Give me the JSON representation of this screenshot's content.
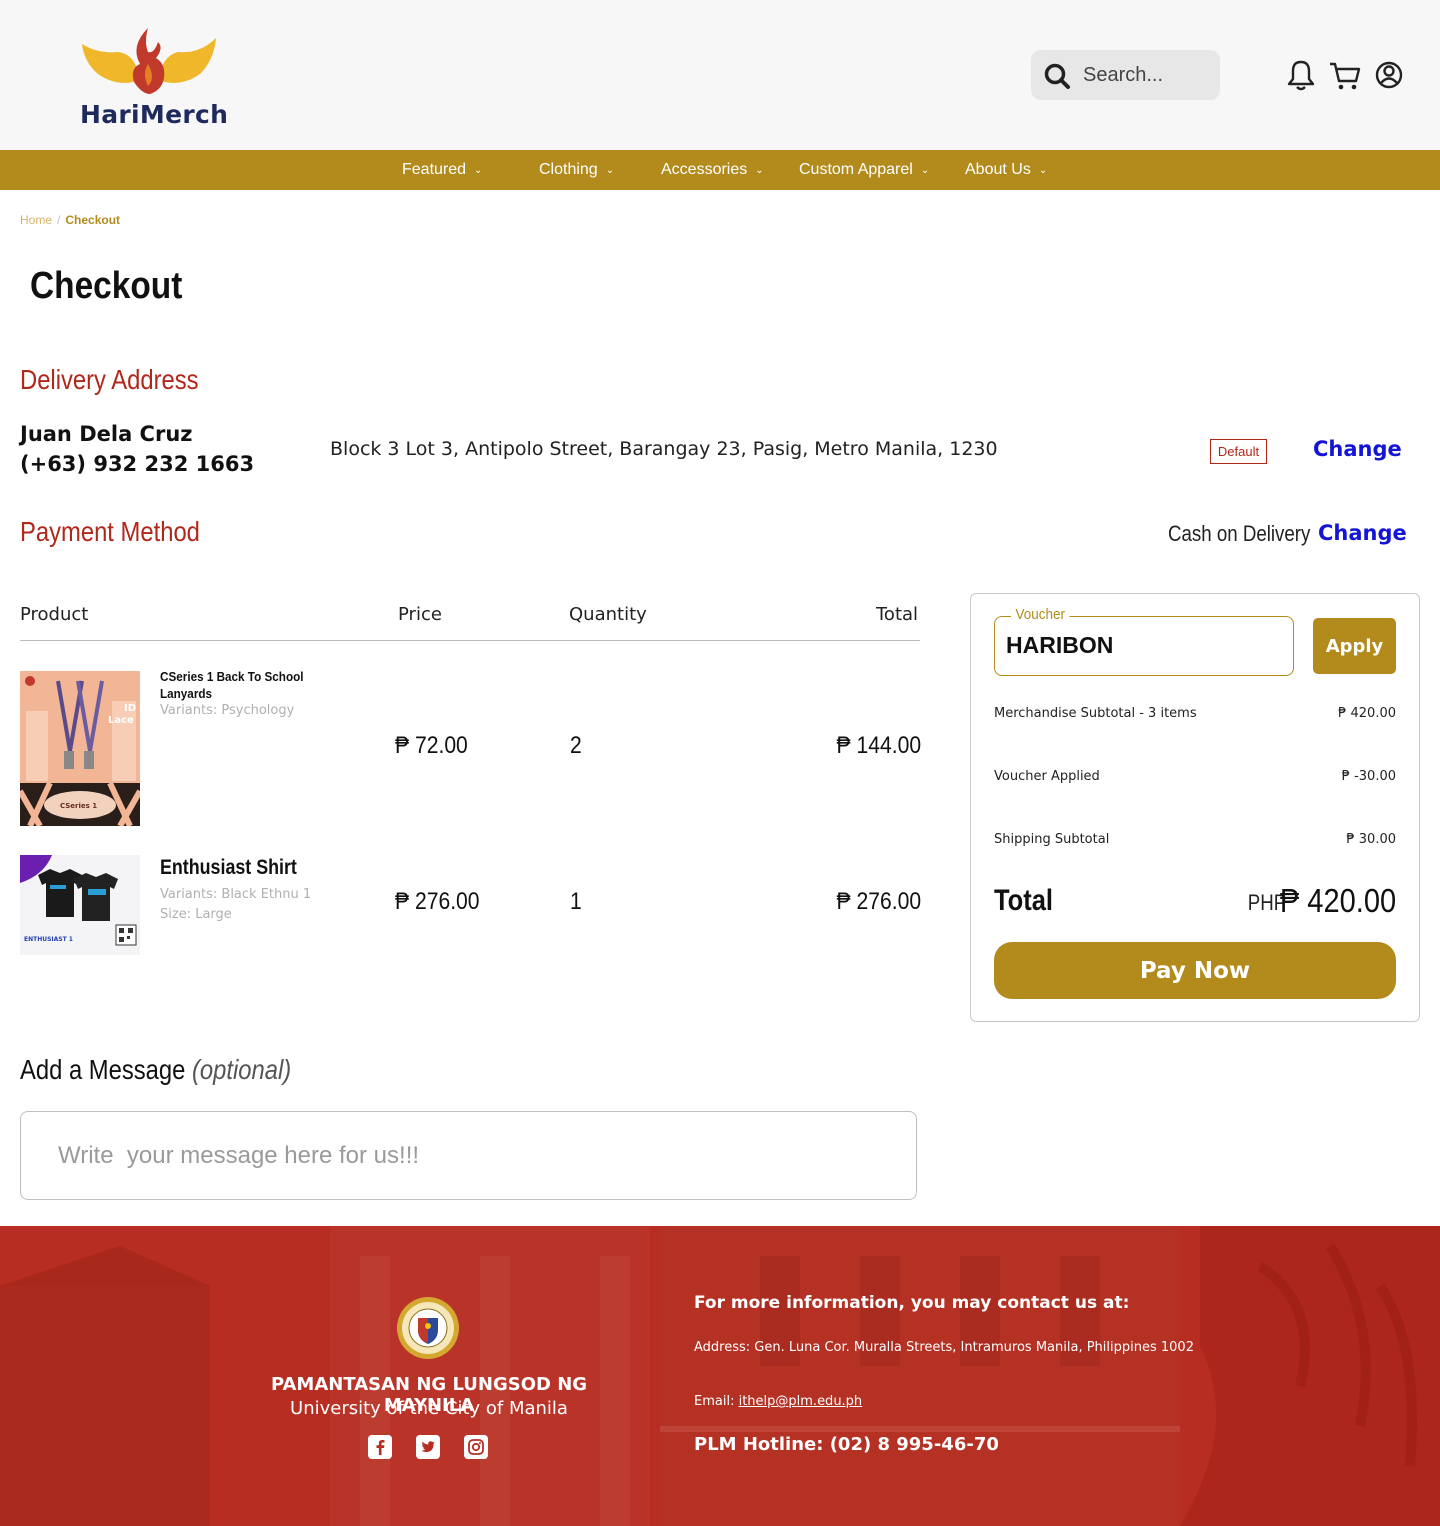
{
  "brand": {
    "name": "HariMerch"
  },
  "search": {
    "placeholder": "Search..."
  },
  "nav": [
    {
      "label": "Featured"
    },
    {
      "label": "Clothing"
    },
    {
      "label": "Accessories"
    },
    {
      "label": "Custom Apparel"
    },
    {
      "label": "About Us"
    }
  ],
  "breadcrumb": {
    "home": "Home",
    "separator": "/",
    "current": "Checkout"
  },
  "page_title": "Checkout",
  "delivery": {
    "title": "Delivery Address",
    "name": "Juan Dela Cruz",
    "phone": "(+63) 932 232 1663",
    "address": "Block 3 Lot 3, Antipolo Street, Barangay 23, Pasig, Metro Manila, 1230",
    "badge": "Default",
    "change_label": "Change"
  },
  "payment": {
    "title": "Payment Method",
    "method": "Cash on Delivery",
    "change_label": "Change"
  },
  "table": {
    "headers": {
      "product": "Product",
      "price": "Price",
      "quantity": "Quantity",
      "total": "Total"
    },
    "items": [
      {
        "title": "CSeries 1 Back To School Lanyards",
        "variant": "Variants: Psychology",
        "size": "",
        "price": "₱ 72.00",
        "quantity": "2",
        "total": "₱ 144.00"
      },
      {
        "title": "Enthusiast Shirt",
        "variant": "Variants:  Black Ethnu 1",
        "size": "Size: Large",
        "price": "₱ 276.00",
        "quantity": "1",
        "total": "₱ 276.00"
      }
    ]
  },
  "summary": {
    "voucher_label": "Voucher",
    "voucher_value": "HARIBON",
    "apply_label": "Apply",
    "merch_label": "Merchandise Subtotal -  3 items",
    "merch_value": "₱ 420.00",
    "voucher_applied_label": "Voucher Applied",
    "voucher_applied_value": "₱ -30.00",
    "shipping_label": "Shipping Subtotal",
    "shipping_value": "₱ 30.00",
    "total_label": "Total",
    "total_currency": "PHP",
    "total_value": "₱ 420.00",
    "pay_label": "Pay Now"
  },
  "message": {
    "title": "Add a Message",
    "optional": "(optional)",
    "placeholder": "Write  your message here for us!!!"
  },
  "footer": {
    "univ_name": "PAMANTASAN NG LUNGSOD NG MAYNILA",
    "univ_sub": "University of the City of Manila",
    "contact_heading": "For more information, you may contact us at:",
    "address": "Address: Gen. Luna Cor. Muralla Streets, Intramuros Manila, Philippines 1002",
    "email_label": "Email: ",
    "email": "ithelp@plm.edu.ph",
    "hotline": "PLM Hotline: (02) 8 995-46-70"
  },
  "colors": {
    "gold": "#b38b1d",
    "red": "#b0281c",
    "link_blue": "#1414d4",
    "footer_red": "#b72d22"
  },
  "icons": [
    "search-icon",
    "bell-icon",
    "cart-icon",
    "user-icon",
    "facebook-icon",
    "twitter-icon",
    "instagram-icon"
  ]
}
